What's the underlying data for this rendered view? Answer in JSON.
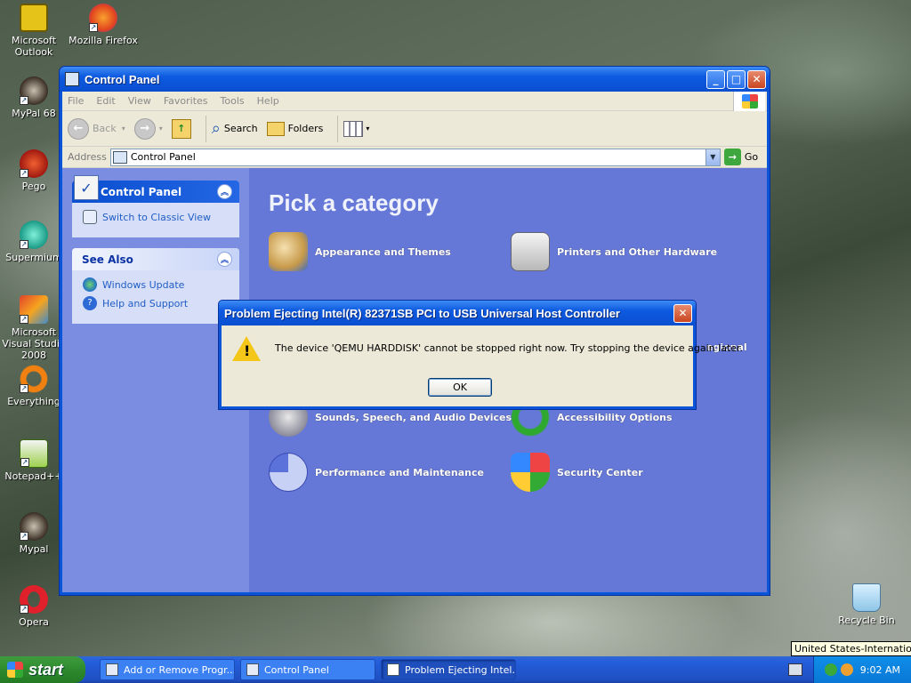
{
  "desktop": {
    "icons": [
      {
        "label": "Microsoft Outlook"
      },
      {
        "label": "Mozilla Firefox"
      },
      {
        "label": "MyPal 68"
      },
      {
        "label": "Pego"
      },
      {
        "label": "Supermium"
      },
      {
        "label": "Microsoft Visual Studio 2008"
      },
      {
        "label": "Everything"
      },
      {
        "label": "Notepad++"
      },
      {
        "label": "Mypal"
      },
      {
        "label": "Opera"
      },
      {
        "label": "Recycle Bin"
      }
    ]
  },
  "window": {
    "title": "Control Panel",
    "menu": [
      "File",
      "Edit",
      "View",
      "Favorites",
      "Tools",
      "Help"
    ],
    "toolbar": {
      "back": "Back",
      "search": "Search",
      "folders": "Folders"
    },
    "address": {
      "label": "Address",
      "value": "Control Panel",
      "go": "Go"
    },
    "left_panel": {
      "control_panel_title": "Control Panel",
      "switch_view": "Switch to Classic View",
      "see_also_title": "See Also",
      "see_also_links": [
        "Windows Update",
        "Help and Support"
      ]
    },
    "main": {
      "heading": "Pick a category",
      "categories": [
        "Appearance and Themes",
        "Printers and Other Hardware",
        "egional",
        "Sounds, Speech, and Audio Devices",
        "Accessibility Options",
        "Performance and Maintenance",
        "Security Center"
      ]
    }
  },
  "dialog": {
    "title": "Problem Ejecting Intel(R) 82371SB PCI to USB Universal Host Controller",
    "message": "The device 'QEMU HARDDISK' cannot be stopped right now.  Try stopping the device again later.",
    "ok": "OK"
  },
  "taskbar": {
    "start": "start",
    "tasks": [
      "Add or Remove Progr...",
      "Control Panel",
      "Problem Ejecting Intel..."
    ],
    "clock": "9:02 AM",
    "tooltip": "United States-International"
  },
  "colors": {
    "xp_blue": "#0a54d8",
    "panel_bg": "#6578d8",
    "start_green": "#2e8a2e",
    "warn_yellow": "#f3c618"
  }
}
